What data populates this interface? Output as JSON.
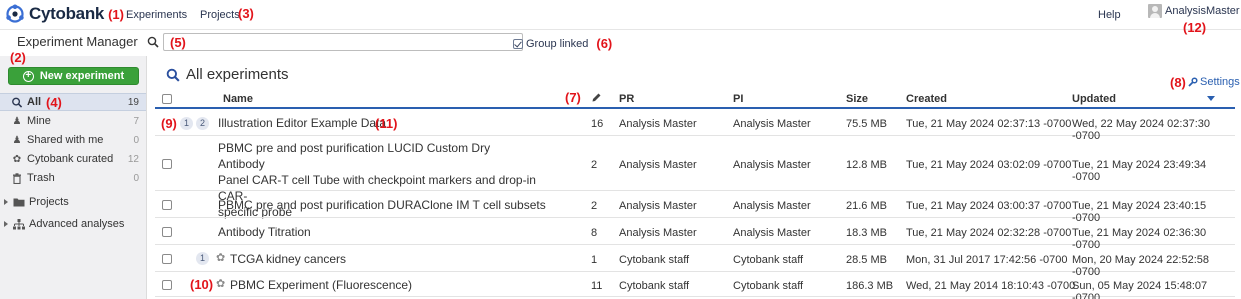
{
  "header": {
    "app_name": "Cytobank",
    "nav": [
      "Experiments",
      "Projects"
    ],
    "help": "Help",
    "user": "AnalysisMaster"
  },
  "annotations": [
    "(1)",
    "(2)",
    "(3)",
    "(4)",
    "(5)",
    "(6)",
    "(7)",
    "(8)",
    "(9)",
    "(10)",
    "(11)",
    "(12)"
  ],
  "toolbar": {
    "title": "Experiment Manager",
    "search_value": "",
    "group_linked": "Group linked",
    "group_linked_checked": true
  },
  "sidebar": {
    "new_experiment": "New experiment",
    "items": [
      {
        "label": "All",
        "count": "19",
        "icon": "search-icon",
        "active": true
      },
      {
        "label": "Mine",
        "count": "7",
        "icon": "user-icon"
      },
      {
        "label": "Shared with me",
        "count": "0",
        "icon": "shared-user-icon"
      },
      {
        "label": "Cytobank curated",
        "count": "12",
        "icon": "cytobank-icon"
      },
      {
        "label": "Trash",
        "count": "0",
        "icon": "trash-icon"
      }
    ],
    "tree": [
      {
        "label": "Projects",
        "icon": "folder-icon"
      },
      {
        "label": "Advanced analyses",
        "icon": "hierarchy-icon"
      }
    ]
  },
  "main": {
    "title": "All experiments",
    "settings": "Settings",
    "columns": [
      "Name",
      "PR",
      "PI",
      "Size",
      "Created",
      "Updated"
    ],
    "sorted_column": "Updated",
    "rows": [
      {
        "badges": [
          "1",
          "2"
        ],
        "curated": false,
        "name": [
          "Illustration Editor Example Data"
        ],
        "files": "16",
        "pr": "Analysis Master",
        "pi": "Analysis Master",
        "size": "75.5 MB",
        "created": "Tue, 21 May 2024 02:37:13 -0700",
        "updated": "Wed, 22 May 2024 02:37:30 -0700"
      },
      {
        "badges": [],
        "curated": false,
        "name": [
          "PBMC pre and post purification LUCID Custom Dry Antibody",
          "Panel CAR-T cell Tube with checkpoint markers and drop-in CAR-",
          "specific probe"
        ],
        "files": "2",
        "pr": "Analysis Master",
        "pi": "Analysis Master",
        "size": "12.8 MB",
        "created": "Tue, 21 May 2024 03:02:09 -0700",
        "updated": "Tue, 21 May 2024 23:49:34 -0700"
      },
      {
        "badges": [],
        "curated": false,
        "name": [
          "PBMC pre and post purification DURAClone IM T cell subsets"
        ],
        "files": "2",
        "pr": "Analysis Master",
        "pi": "Analysis Master",
        "size": "21.6 MB",
        "created": "Tue, 21 May 2024 03:00:37 -0700",
        "updated": "Tue, 21 May 2024 23:40:15 -0700"
      },
      {
        "badges": [],
        "curated": false,
        "name": [
          "Antibody Titration"
        ],
        "files": "8",
        "pr": "Analysis Master",
        "pi": "Analysis Master",
        "size": "18.3 MB",
        "created": "Tue, 21 May 2024 02:32:28 -0700",
        "updated": "Tue, 21 May 2024 02:36:30 -0700"
      },
      {
        "badges": [
          "1"
        ],
        "curated": true,
        "name": [
          "TCGA kidney cancers"
        ],
        "files": "1",
        "pr": "Cytobank staff",
        "pi": "Cytobank staff",
        "size": "28.5 MB",
        "created": "Mon, 31 Jul 2017 17:42:56 -0700",
        "updated": "Mon, 20 May 2024 22:52:58 -0700"
      },
      {
        "badges": [],
        "curated": true,
        "name": [
          "PBMC Experiment (Fluorescence)"
        ],
        "files": "11",
        "pr": "Cytobank staff",
        "pi": "Cytobank staff",
        "size": "186.3 MB",
        "created": "Wed, 21 May 2014 18:10:43 -0700",
        "updated": "Sun, 05 May 2024 15:48:07 -0700"
      }
    ]
  }
}
